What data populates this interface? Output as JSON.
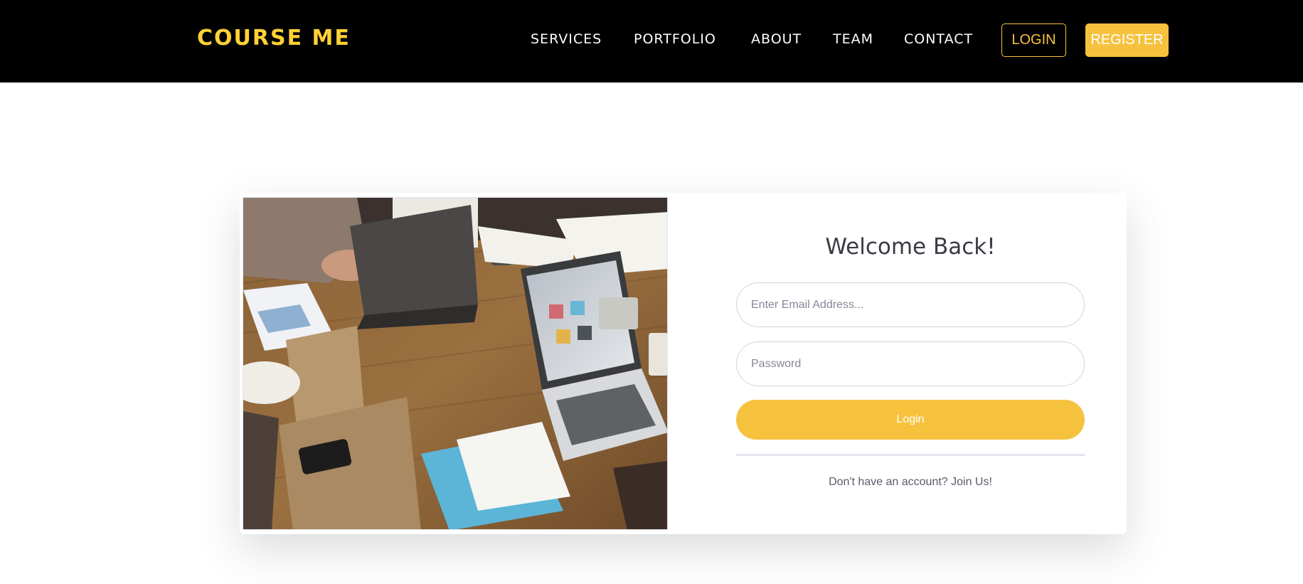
{
  "brand": "COURSE ME",
  "nav": {
    "links": [
      "SERVICES",
      "PORTFOLIO",
      "ABOUT",
      "TEAM",
      "CONTACT"
    ],
    "login_label": "LOGIN",
    "register_label": "REGISTER"
  },
  "form": {
    "heading": "Welcome Back!",
    "email_placeholder": "Enter Email Address...",
    "password_placeholder": "Password",
    "submit_label": "Login",
    "join_text": "Don't have an account? Join Us!"
  },
  "colors": {
    "accent": "#f6c23e",
    "brand": "#fed136",
    "navbar": "#000000"
  }
}
